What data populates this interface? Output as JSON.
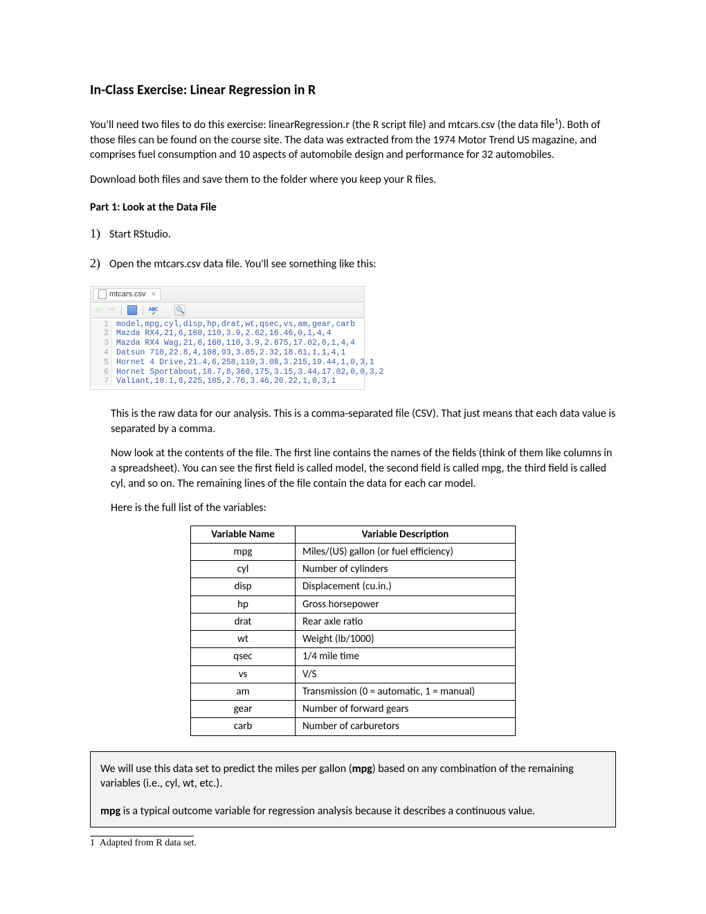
{
  "title": "In-Class Exercise: Linear Regression in R",
  "intro1_a": "You'll need two files to do this exercise: linearRegression.r (the R script file) and mtcars.csv (the data file",
  "intro1_b": "). Both of those files can be found on the course site. The data was extracted from the 1974 Motor Trend US magazine, and comprises fuel consumption and 10 aspects of automobile design and performance for 32 automobiles.",
  "intro2": "Download both files and save them to the folder where you keep your R files.",
  "part1_heading": "Part 1: Look at the Data File",
  "steps": {
    "s1_num": "1)",
    "s1_text": "Start RStudio.",
    "s2_num": "2)",
    "s2_text": "Open the mtcars.csv data file. You'll see something like this:"
  },
  "rstudio": {
    "tab_label": "mtcars.csv",
    "tab_close": "×",
    "abc_label": "ABC",
    "lines": [
      "model,mpg,cyl,disp,hp,drat,wt,qsec,vs,am,gear,carb",
      "Mazda RX4,21,6,160,110,3.9,2.62,16.46,0,1,4,4",
      "Mazda RX4 Wag,21,6,160,110,3.9,2.875,17.02,0,1,4,4",
      "Datsun 710,22.8,4,108,93,3.85,2.32,18.61,1,1,4,1",
      "Hornet 4 Drive,21.4,6,258,110,3.08,3.215,19.44,1,0,3,1",
      "Hornet Sportabout,18.7,8,360,175,3.15,3.44,17.02,0,0,3,2",
      "Valiant,18.1,6,225,105,2.76,3.46,20.22,1,0,3,1"
    ]
  },
  "after_screenshot": {
    "p1": "This is the raw data for our analysis. This is a comma-separated file (CSV). That just means that each data value is separated by a comma.",
    "p2": "Now look at the contents of the file. The first line contains the names of the fields (think of them like columns in a spreadsheet). You can see the first field is called model, the second field is called mpg, the third field is called cyl, and so on. The remaining lines of the file contain the data for each car model.",
    "p3": "Here is the full list of the variables:"
  },
  "table": {
    "h1": "Variable Name",
    "h2": "Variable Description",
    "rows": [
      {
        "name": "mpg",
        "desc": "Miles/(US) gallon (or fuel efficiency)"
      },
      {
        "name": "cyl",
        "desc": "Number of cylinders"
      },
      {
        "name": "disp",
        "desc": "Displacement (cu.in.)"
      },
      {
        "name": "hp",
        "desc": "Gross horsepower"
      },
      {
        "name": "drat",
        "desc": "Rear axle ratio"
      },
      {
        "name": "wt",
        "desc": "Weight (lb/1000)"
      },
      {
        "name": "qsec",
        "desc": "1/4 mile time"
      },
      {
        "name": "vs",
        "desc": "V/S"
      },
      {
        "name": "am",
        "desc": "Transmission (0 = automatic, 1 = manual)"
      },
      {
        "name": "gear",
        "desc": "Number of forward gears"
      },
      {
        "name": "carb",
        "desc": "Number of carburetors"
      }
    ]
  },
  "callout": {
    "p1_a": "We will use this data set to predict the miles per gallon (",
    "p1_bold": "mpg",
    "p1_b": ") based on any combination of the remaining variables (i.e., cyl, wt, etc.).",
    "p2_bold": "mpg",
    "p2_rest": " is a typical outcome variable for regression analysis because it describes a continuous value."
  },
  "footnote": {
    "num": "1",
    "text": " Adapted from R data set."
  }
}
